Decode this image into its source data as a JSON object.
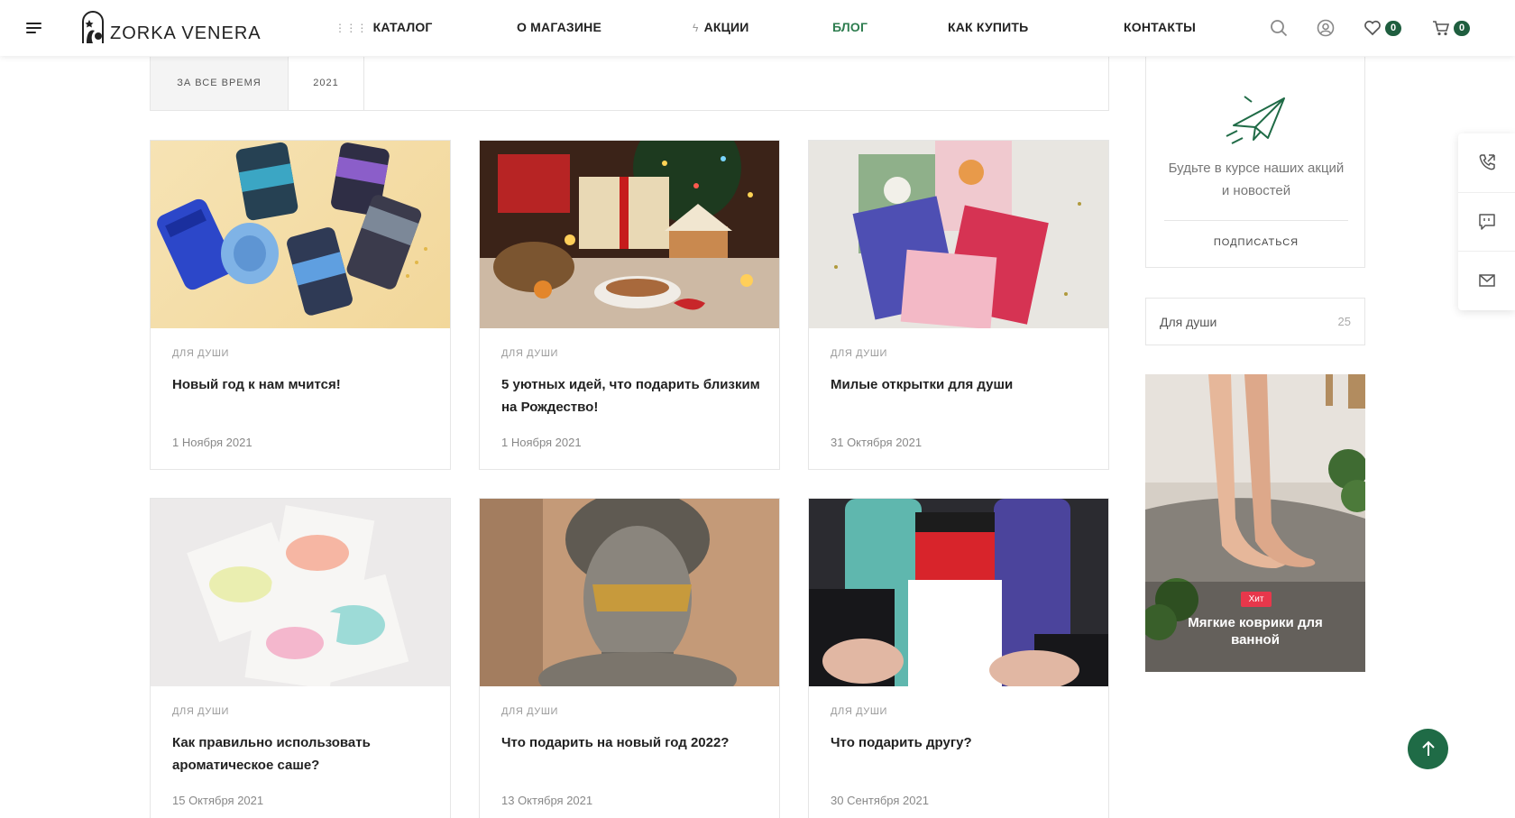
{
  "header": {
    "logo_text": "ZORKA VENERA",
    "nav": [
      "КАТАЛОГ",
      "О МАГАЗИНЕ",
      "АКЦИИ",
      "БЛОГ",
      "КАК КУПИТЬ",
      "КОНТАКТЫ"
    ],
    "active_nav": "БЛОГ",
    "wishlist_count": "0",
    "cart_count": "0"
  },
  "filters": [
    "ЗА ВСЕ ВРЕМЯ",
    "2021"
  ],
  "posts": [
    {
      "category": "ДЛЯ ДУШИ",
      "title": "Новый год к нам мчится!",
      "date": "1 Ноября 2021"
    },
    {
      "category": "ДЛЯ ДУШИ",
      "title": "5 уютных идей, что подарить близким на Рождество!",
      "date": "1 Ноября 2021"
    },
    {
      "category": "ДЛЯ ДУШИ",
      "title": "Милые открытки для души",
      "date": "31 Октября 2021"
    },
    {
      "category": "ДЛЯ ДУШИ",
      "title": "Как правильно использовать ароматическое саше?",
      "date": "15 Октября 2021"
    },
    {
      "category": "ДЛЯ ДУШИ",
      "title": "Что подарить на новый год 2022?",
      "date": "13 Октября 2021"
    },
    {
      "category": "ДЛЯ ДУШИ",
      "title": "Что подарить другу?",
      "date": "30 Сентября 2021"
    }
  ],
  "sidebar": {
    "subscribe_text": "Будьте в курсе наших акций и новостей",
    "subscribe_button": "ПОДПИСАТЬСЯ",
    "tag_label": "Для души",
    "tag_count": "25",
    "promo_badge": "Хит",
    "promo_title": "Мягкие коврики для ванной"
  },
  "colors": {
    "accent": "#2e7d4f",
    "badge": "#1f5e3f",
    "hit": "#e8374b"
  }
}
